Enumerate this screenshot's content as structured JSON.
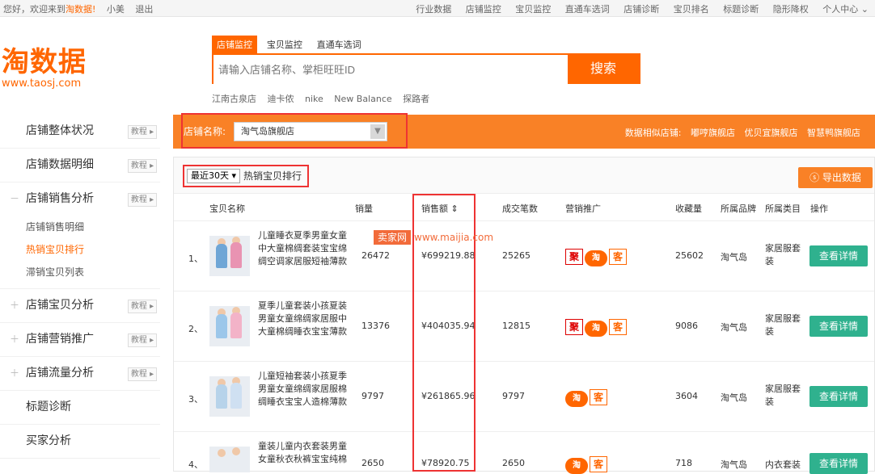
{
  "topbar": {
    "greeting": "您好，欢迎来到",
    "brand": "淘数据!",
    "user": "小美",
    "logout": "退出",
    "nav": [
      "行业数据",
      "店铺监控",
      "宝贝监控",
      "直通车选词",
      "店铺诊断",
      "宝贝排名",
      "标题诊断",
      "隐形降权",
      "个人中心 ⌄"
    ]
  },
  "logo": {
    "cn": "淘数据",
    "en": "www.taosj.com"
  },
  "search": {
    "tabs": [
      "店铺监控",
      "宝贝监控",
      "直通车选词"
    ],
    "placeholder": "请输入店铺名称、掌柜旺旺ID",
    "button": "搜索",
    "hot": [
      "江南古泉店",
      "迪卡侬",
      "nike",
      "New Balance",
      "探路者"
    ]
  },
  "sidebar": {
    "items": [
      {
        "pre": "",
        "label": "店铺整体状况",
        "tut": "教程 ▸"
      },
      {
        "pre": "",
        "label": "店铺数据明细",
        "tut": "教程 ▸"
      },
      {
        "pre": "－",
        "label": "店铺销售分析",
        "tut": "教程 ▸"
      }
    ],
    "sub": [
      "店铺销售明细",
      "热销宝贝排行",
      "滞销宝贝列表"
    ],
    "items2": [
      {
        "pre": "＋",
        "label": "店铺宝贝分析",
        "tut": "教程 ▸"
      },
      {
        "pre": "＋",
        "label": "店铺营销推广",
        "tut": "教程 ▸"
      },
      {
        "pre": "＋",
        "label": "店铺流量分析",
        "tut": "教程 ▸"
      },
      {
        "pre": "",
        "label": "标题诊断",
        "tut": ""
      },
      {
        "pre": "",
        "label": "买家分析",
        "tut": ""
      }
    ]
  },
  "shopbar": {
    "label": "店铺名称:",
    "selected": "淘气岛旗舰店",
    "similar_label": "数据相似店铺:",
    "similar": [
      "嘟哼旗舰店",
      "优贝宜旗舰店",
      "智慧鸭旗舰店"
    ]
  },
  "panel": {
    "period": "最近30天 ▾",
    "title": "热销宝贝排行",
    "export": "导出数据",
    "headers": [
      "宝贝名称",
      "销量",
      "销售额 ⇕",
      "成交笔数",
      "营销推广",
      "收藏量",
      "所属品牌",
      "所属类目",
      "操作"
    ],
    "detail_label": "查看详情",
    "rows": [
      {
        "rank": "1、",
        "title": "儿童睡衣夏季男童女童中大童棉绸套装宝宝绵绸空调家居服短袖薄款",
        "sales": "26472",
        "amount": "¥699219.88",
        "orders": "25265",
        "promo": [
          "聚",
          "淘",
          "客"
        ],
        "fav": "25602",
        "brand": "淘气岛",
        "category": "家居服套装"
      },
      {
        "rank": "2、",
        "title": "夏季儿童套装小孩夏装男童女童绵绸家居服中大童棉绸睡衣宝宝薄款",
        "sales": "13376",
        "amount": "¥404035.94",
        "orders": "12815",
        "promo": [
          "聚",
          "淘",
          "客"
        ],
        "fav": "9086",
        "brand": "淘气岛",
        "category": "家居服套装"
      },
      {
        "rank": "3、",
        "title": "儿童短袖套装小孩夏季男童女童绵绸家居服棉绸睡衣宝宝人造棉薄款",
        "sales": "9797",
        "amount": "¥261865.96",
        "orders": "9797",
        "promo": [
          "淘",
          "客"
        ],
        "fav": "3604",
        "brand": "淘气岛",
        "category": "家居服套装"
      },
      {
        "rank": "4、",
        "title": "童装儿童内衣套装男童女童秋衣秋裤宝宝纯棉",
        "sales": "2650",
        "amount": "¥78920.75",
        "orders": "2650",
        "promo": [
          "淘",
          "客"
        ],
        "fav": "718",
        "brand": "淘气岛",
        "category": "内衣套装"
      }
    ]
  },
  "watermark": {
    "badge": "卖家网",
    "url": "www.maijia.com"
  }
}
